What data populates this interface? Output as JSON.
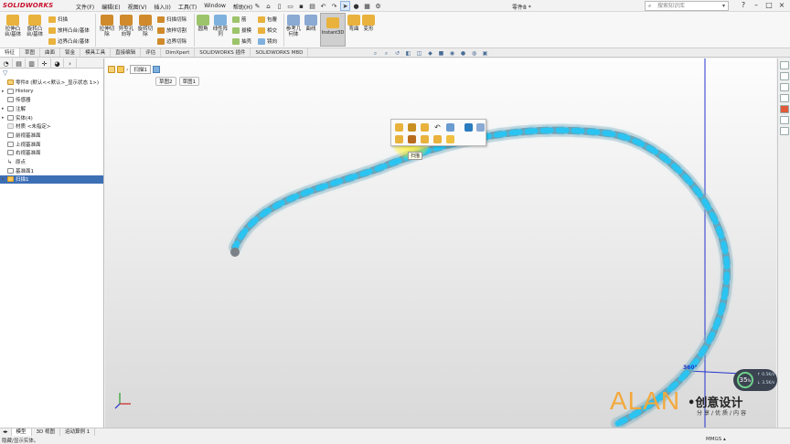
{
  "titlebar": {
    "logo_text": "SOLIDWORKS",
    "menus": [
      "文件(F)",
      "编辑(E)",
      "视图(V)",
      "插入(I)",
      "工具(T)",
      "Window",
      "帮助(H)"
    ],
    "doc_title": "零件8 *",
    "search_placeholder": "搜索知识库"
  },
  "ribbon": {
    "boss_extrude": "拉伸凸台/基体",
    "boss_revolve": "旋转凸台/基体",
    "sweep": "扫描",
    "loft_boss": "放样凸台/基体",
    "boundary_boss": "边界凸台/基体",
    "cut_extrude": "拉伸切除",
    "hole_wizard": "异型孔向导",
    "cut_revolve": "旋转切除",
    "cut_sweep": "扫描切除",
    "cut_loft": "放样切割",
    "cut_boundary": "边界切除",
    "fillet": "圆角",
    "linear_pattern": "线性阵列",
    "rib": "筋",
    "draft": "拔模",
    "shell": "抽壳",
    "wrap": "包覆",
    "intersect": "相交",
    "mirror": "镜向",
    "ref_geometry": "参考几何体",
    "curves": "曲线",
    "instant3d": "Instant3D",
    "flex": "弯曲",
    "deform": "变形"
  },
  "tabs": [
    "特征",
    "草图",
    "曲面",
    "钣金",
    "模具工具",
    "直接编辑",
    "评估",
    "DimXpert",
    "SOLIDWORKS 插件",
    "SOLIDWORKS MBD"
  ],
  "tree": [
    {
      "label": "零件8 (默认<<默认>_显示状态 1>)",
      "expand": ""
    },
    {
      "label": "History",
      "expand": "▸"
    },
    {
      "label": "传感器",
      "expand": ""
    },
    {
      "label": "注解",
      "expand": "▸"
    },
    {
      "label": "实体(4)",
      "expand": "▸"
    },
    {
      "label": "材质 <未指定>",
      "expand": ""
    },
    {
      "label": "前视基准面",
      "expand": ""
    },
    {
      "label": "上视基准面",
      "expand": ""
    },
    {
      "label": "右视基准面",
      "expand": ""
    },
    {
      "label": "原点",
      "expand": ""
    },
    {
      "label": "基准面1",
      "expand": ""
    },
    {
      "label": "扫描1",
      "expand": "▸"
    }
  ],
  "breadcrumb": {
    "item": "扫描1",
    "sub1": "草图2",
    "sub2": "草图1"
  },
  "context_toolbar": {
    "tooltip": "扫描"
  },
  "heads_up": {
    "rotation": "360°"
  },
  "perf_widget": {
    "percent": "35",
    "percent_suffix": "%",
    "up": "0.5K/s",
    "down": "3.5K/s"
  },
  "watermark": {
    "brand": "ALAN",
    "name": "创意设计",
    "tagline": "分享/优质/内容"
  },
  "status": {
    "bottom_tabs": [
      "模型",
      "3D 视图",
      "运动算例 1"
    ],
    "message": "隐藏/显示实体。",
    "units": "MMGS"
  },
  "colors": {
    "accent": "#3d6fb5",
    "cyan_strand": "#29c4f2",
    "silver_strand": "#b9bfc5",
    "brand": "#c8102e",
    "watermark": "#f3a93c"
  }
}
